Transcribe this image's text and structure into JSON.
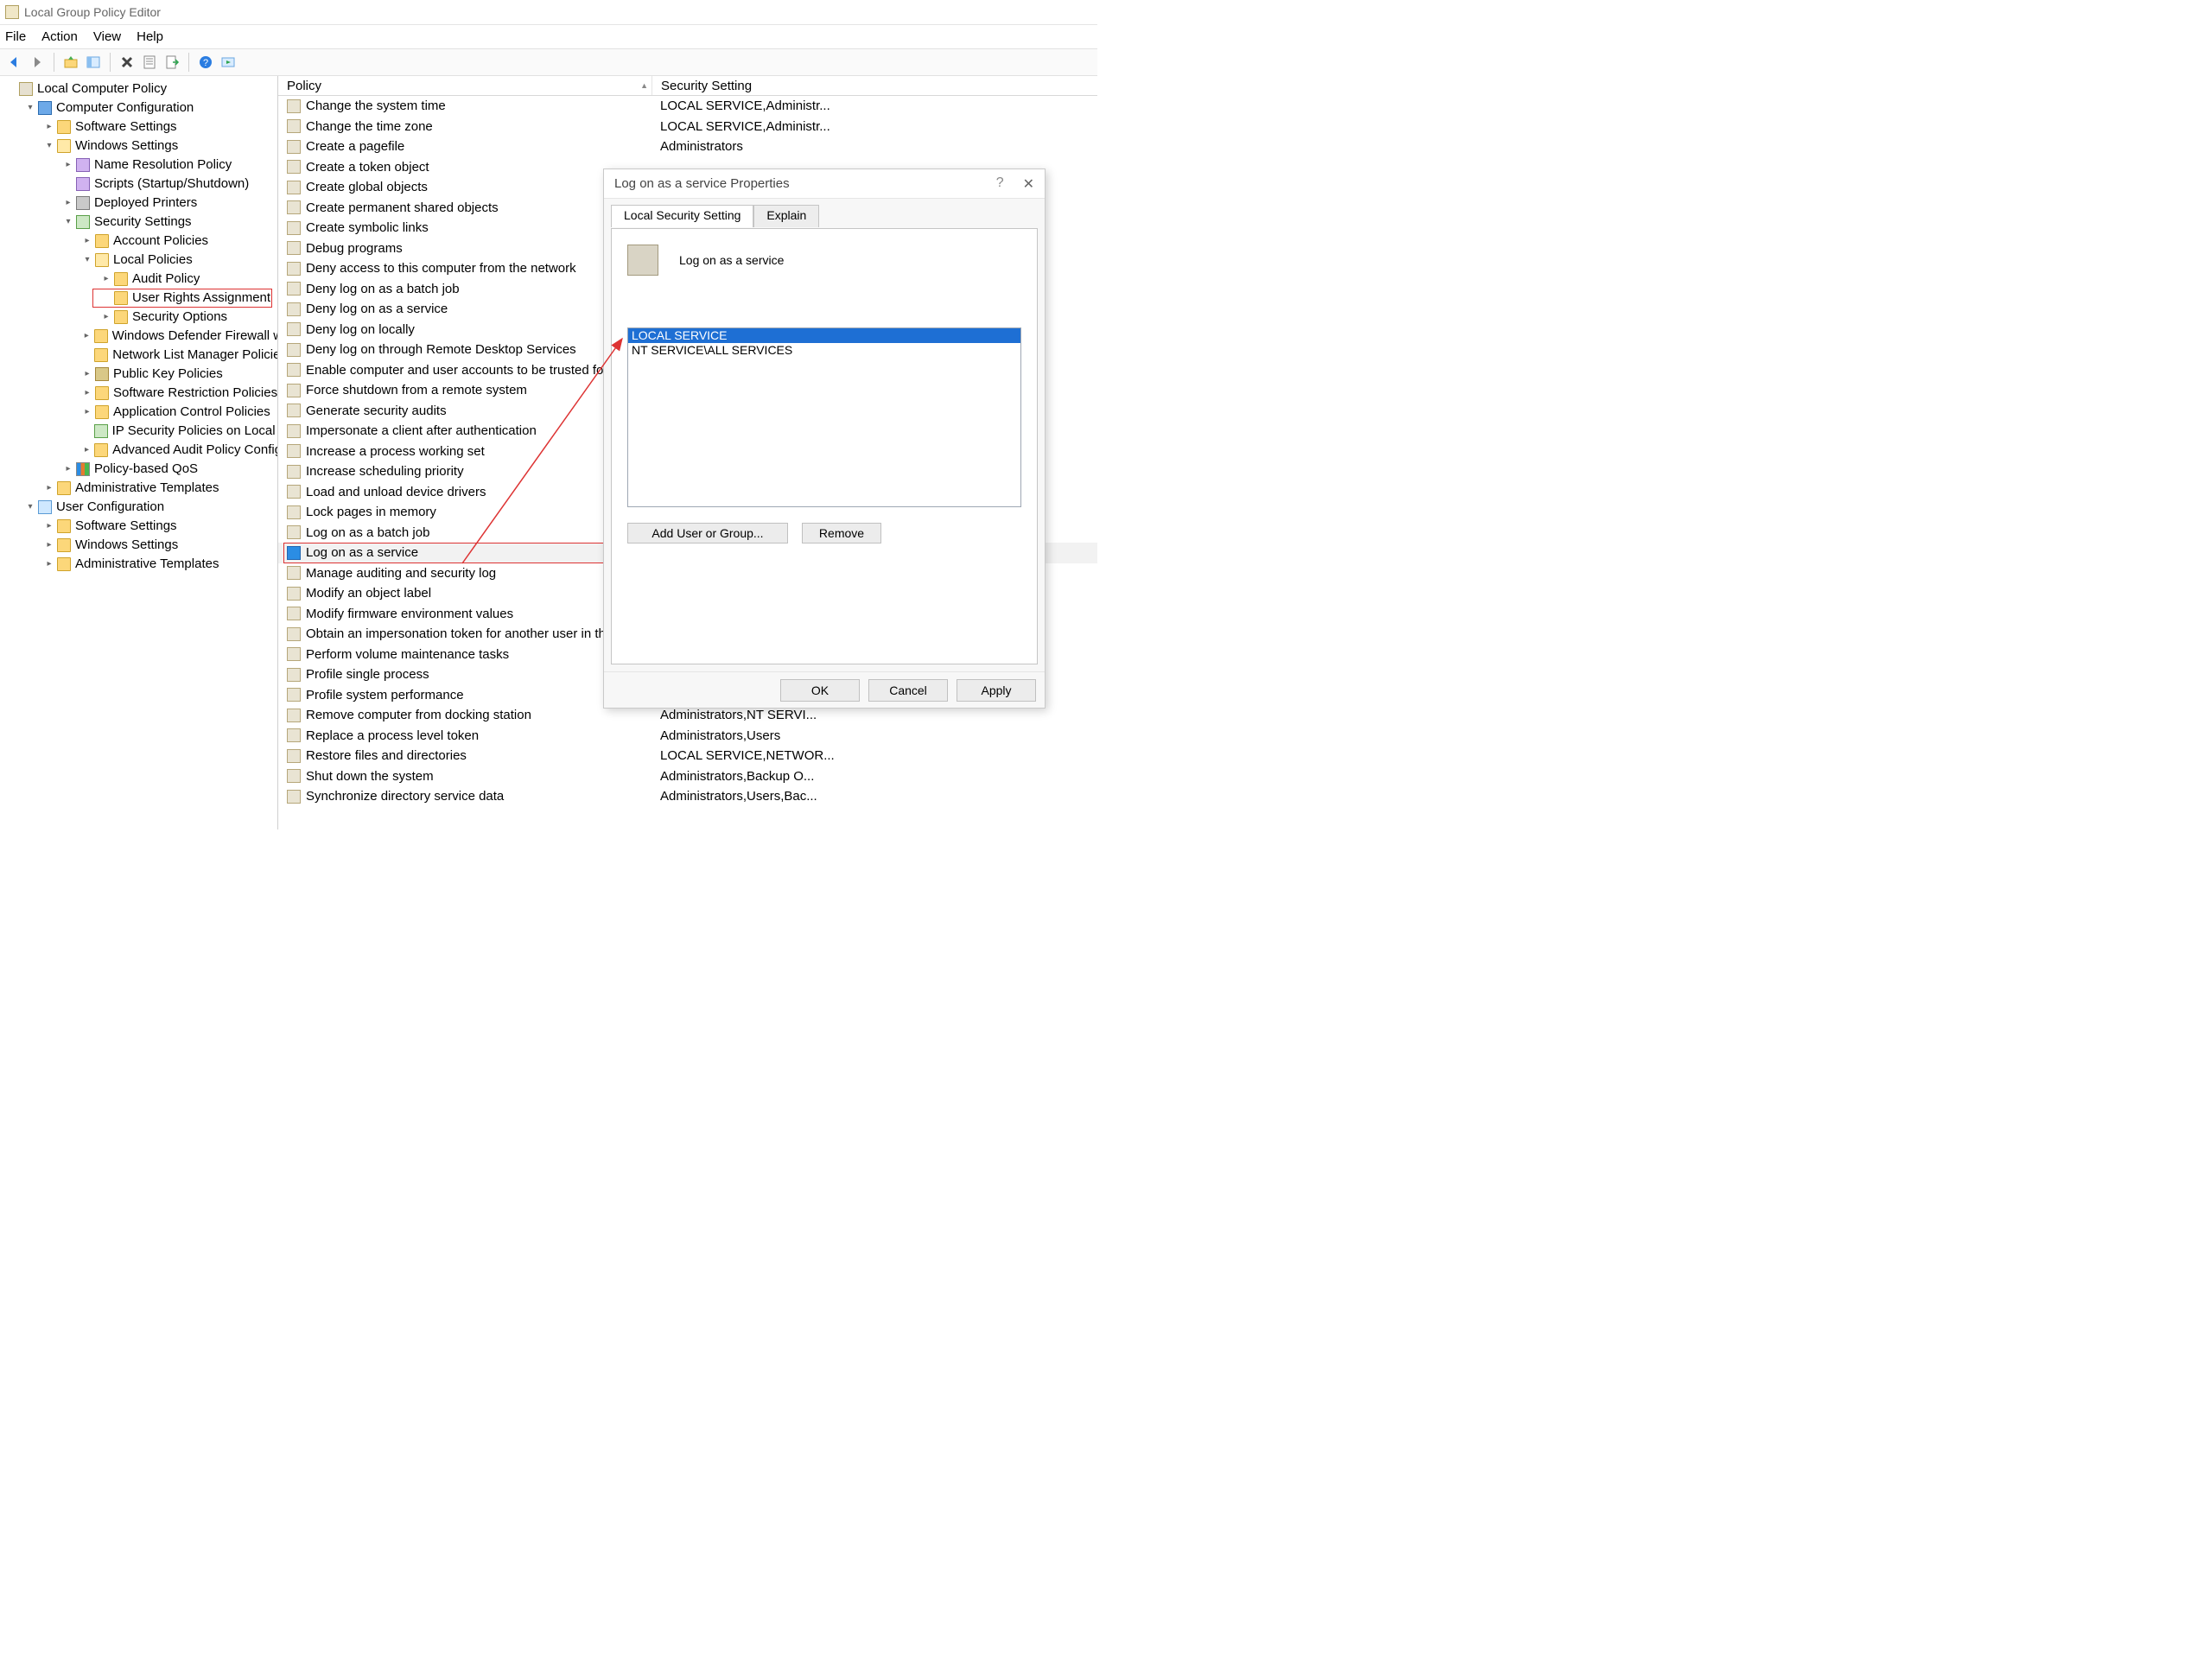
{
  "title": "Local Group Policy Editor",
  "menus": [
    "File",
    "Action",
    "View",
    "Help"
  ],
  "tree": [
    {
      "d": 0,
      "c": "",
      "i": "policy-root",
      "l": "Local Computer Policy"
    },
    {
      "d": 1,
      "c": "v",
      "i": "comp",
      "l": "Computer Configuration"
    },
    {
      "d": 2,
      "c": ">",
      "i": "folder",
      "l": "Software Settings"
    },
    {
      "d": 2,
      "c": "v",
      "i": "folder-o",
      "l": "Windows Settings"
    },
    {
      "d": 3,
      "c": ">",
      "i": "book",
      "l": "Name Resolution Policy"
    },
    {
      "d": 3,
      "c": "",
      "i": "book",
      "l": "Scripts (Startup/Shutdown)"
    },
    {
      "d": 3,
      "c": ">",
      "i": "printer",
      "l": "Deployed Printers"
    },
    {
      "d": 3,
      "c": "v",
      "i": "shield",
      "l": "Security Settings"
    },
    {
      "d": 4,
      "c": ">",
      "i": "folder",
      "l": "Account Policies"
    },
    {
      "d": 4,
      "c": "v",
      "i": "folder-o",
      "l": "Local Policies"
    },
    {
      "d": 5,
      "c": ">",
      "i": "folder",
      "l": "Audit Policy"
    },
    {
      "d": 5,
      "c": "",
      "i": "folder",
      "l": "User Rights Assignment",
      "hi": true
    },
    {
      "d": 5,
      "c": ">",
      "i": "folder",
      "l": "Security Options"
    },
    {
      "d": 4,
      "c": ">",
      "i": "folder",
      "l": "Windows Defender Firewall with"
    },
    {
      "d": 4,
      "c": "",
      "i": "folder",
      "l": "Network List Manager Policies"
    },
    {
      "d": 4,
      "c": ">",
      "i": "key",
      "l": "Public Key Policies"
    },
    {
      "d": 4,
      "c": ">",
      "i": "folder",
      "l": "Software Restriction Policies"
    },
    {
      "d": 4,
      "c": ">",
      "i": "folder",
      "l": "Application Control Policies"
    },
    {
      "d": 4,
      "c": "",
      "i": "shield",
      "l": "IP Security Policies on Local Co"
    },
    {
      "d": 4,
      "c": ">",
      "i": "folder",
      "l": "Advanced Audit Policy Configu"
    },
    {
      "d": 3,
      "c": ">",
      "i": "qos",
      "l": "Policy-based QoS"
    },
    {
      "d": 2,
      "c": ">",
      "i": "folder",
      "l": "Administrative Templates"
    },
    {
      "d": 1,
      "c": "v",
      "i": "user",
      "l": "User Configuration"
    },
    {
      "d": 2,
      "c": ">",
      "i": "folder",
      "l": "Software Settings"
    },
    {
      "d": 2,
      "c": ">",
      "i": "folder",
      "l": "Windows Settings"
    },
    {
      "d": 2,
      "c": ">",
      "i": "folder",
      "l": "Administrative Templates"
    }
  ],
  "columns": {
    "policy": "Policy",
    "security": "Security Setting"
  },
  "rows": [
    {
      "p": "Change the system time",
      "s": "LOCAL SERVICE,Administr..."
    },
    {
      "p": "Change the time zone",
      "s": "LOCAL SERVICE,Administr..."
    },
    {
      "p": "Create a pagefile",
      "s": "Administrators"
    },
    {
      "p": "Create a token object",
      "s": ""
    },
    {
      "p": "Create global objects",
      "s": ""
    },
    {
      "p": "Create permanent shared objects",
      "s": ""
    },
    {
      "p": "Create symbolic links",
      "s": ""
    },
    {
      "p": "Debug programs",
      "s": ""
    },
    {
      "p": "Deny access to this computer from the network",
      "s": ""
    },
    {
      "p": "Deny log on as a batch job",
      "s": ""
    },
    {
      "p": "Deny log on as a service",
      "s": ""
    },
    {
      "p": "Deny log on locally",
      "s": ""
    },
    {
      "p": "Deny log on through Remote Desktop Services",
      "s": ""
    },
    {
      "p": "Enable computer and user accounts to be trusted for d",
      "s": ""
    },
    {
      "p": "Force shutdown from a remote system",
      "s": ""
    },
    {
      "p": "Generate security audits",
      "s": ""
    },
    {
      "p": "Impersonate a client after authentication",
      "s": ""
    },
    {
      "p": "Increase a process working set",
      "s": ""
    },
    {
      "p": "Increase scheduling priority",
      "s": ""
    },
    {
      "p": "Load and unload device drivers",
      "s": ""
    },
    {
      "p": "Lock pages in memory",
      "s": ""
    },
    {
      "p": "Log on as a batch job",
      "s": ""
    },
    {
      "p": "Log on as a service",
      "s": "",
      "sel": true,
      "hi": true
    },
    {
      "p": "Manage auditing and security log",
      "s": ""
    },
    {
      "p": "Modify an object label",
      "s": ""
    },
    {
      "p": "Modify firmware environment values",
      "s": ""
    },
    {
      "p": "Obtain an impersonation token for another user in the",
      "s": ""
    },
    {
      "p": "Perform volume maintenance tasks",
      "s": ""
    },
    {
      "p": "Profile single process",
      "s": ""
    },
    {
      "p": "Profile system performance",
      "s": ""
    },
    {
      "p": "Remove computer from docking station",
      "s": "Administrators,NT SERVI..."
    },
    {
      "p": "Replace a process level token",
      "s": "Administrators,Users"
    },
    {
      "p": "Restore files and directories",
      "s": "LOCAL SERVICE,NETWOR..."
    },
    {
      "p": "Shut down the system",
      "s": "Administrators,Backup O..."
    },
    {
      "p": "Synchronize directory service data",
      "s": "Administrators,Users,Bac..."
    }
  ],
  "dialog": {
    "title": "Log on as a service Properties",
    "tabs": [
      "Local Security Setting",
      "Explain"
    ],
    "heading": "Log on as a service",
    "users": [
      {
        "name": "LOCAL SERVICE",
        "sel": true
      },
      {
        "name": "NT SERVICE\\ALL SERVICES",
        "sel": false
      }
    ],
    "add_btn": "Add User or Group...",
    "remove_btn": "Remove",
    "ok": "OK",
    "cancel": "Cancel",
    "apply": "Apply",
    "help": "?",
    "close": "✕"
  }
}
